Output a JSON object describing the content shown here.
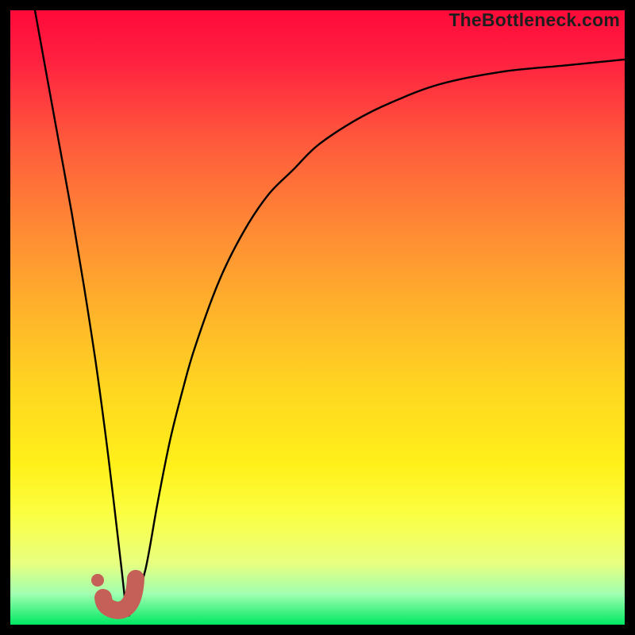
{
  "watermark": "TheBottleneck.com",
  "chart_data": {
    "type": "line",
    "title": "",
    "xlabel": "",
    "ylabel": "",
    "xlim": [
      0,
      100
    ],
    "ylim": [
      0,
      100
    ],
    "grid": false,
    "legend": false,
    "note": "Values are estimated from pixel positions; y is read as distance above the bottom of the gradient frame (0) to the top (100). The curve plunges to near-zero around x≈18–19 then asymptotically rises toward ~92.",
    "series": [
      {
        "name": "bottleneck-curve",
        "x": [
          4,
          6,
          8,
          10,
          12,
          14,
          16,
          18,
          19,
          20,
          22,
          24,
          26,
          28,
          30,
          34,
          38,
          42,
          46,
          50,
          56,
          62,
          70,
          80,
          90,
          100
        ],
        "y": [
          100,
          89,
          78,
          67,
          55,
          42,
          27,
          10,
          2,
          3,
          9,
          20,
          30,
          38,
          45,
          56,
          64,
          70,
          74,
          78,
          82,
          85,
          88,
          90,
          91,
          92
        ]
      }
    ],
    "marker": {
      "name": "j-glyph",
      "approx_x": 18,
      "approx_y": 3,
      "color": "#c56058"
    }
  }
}
